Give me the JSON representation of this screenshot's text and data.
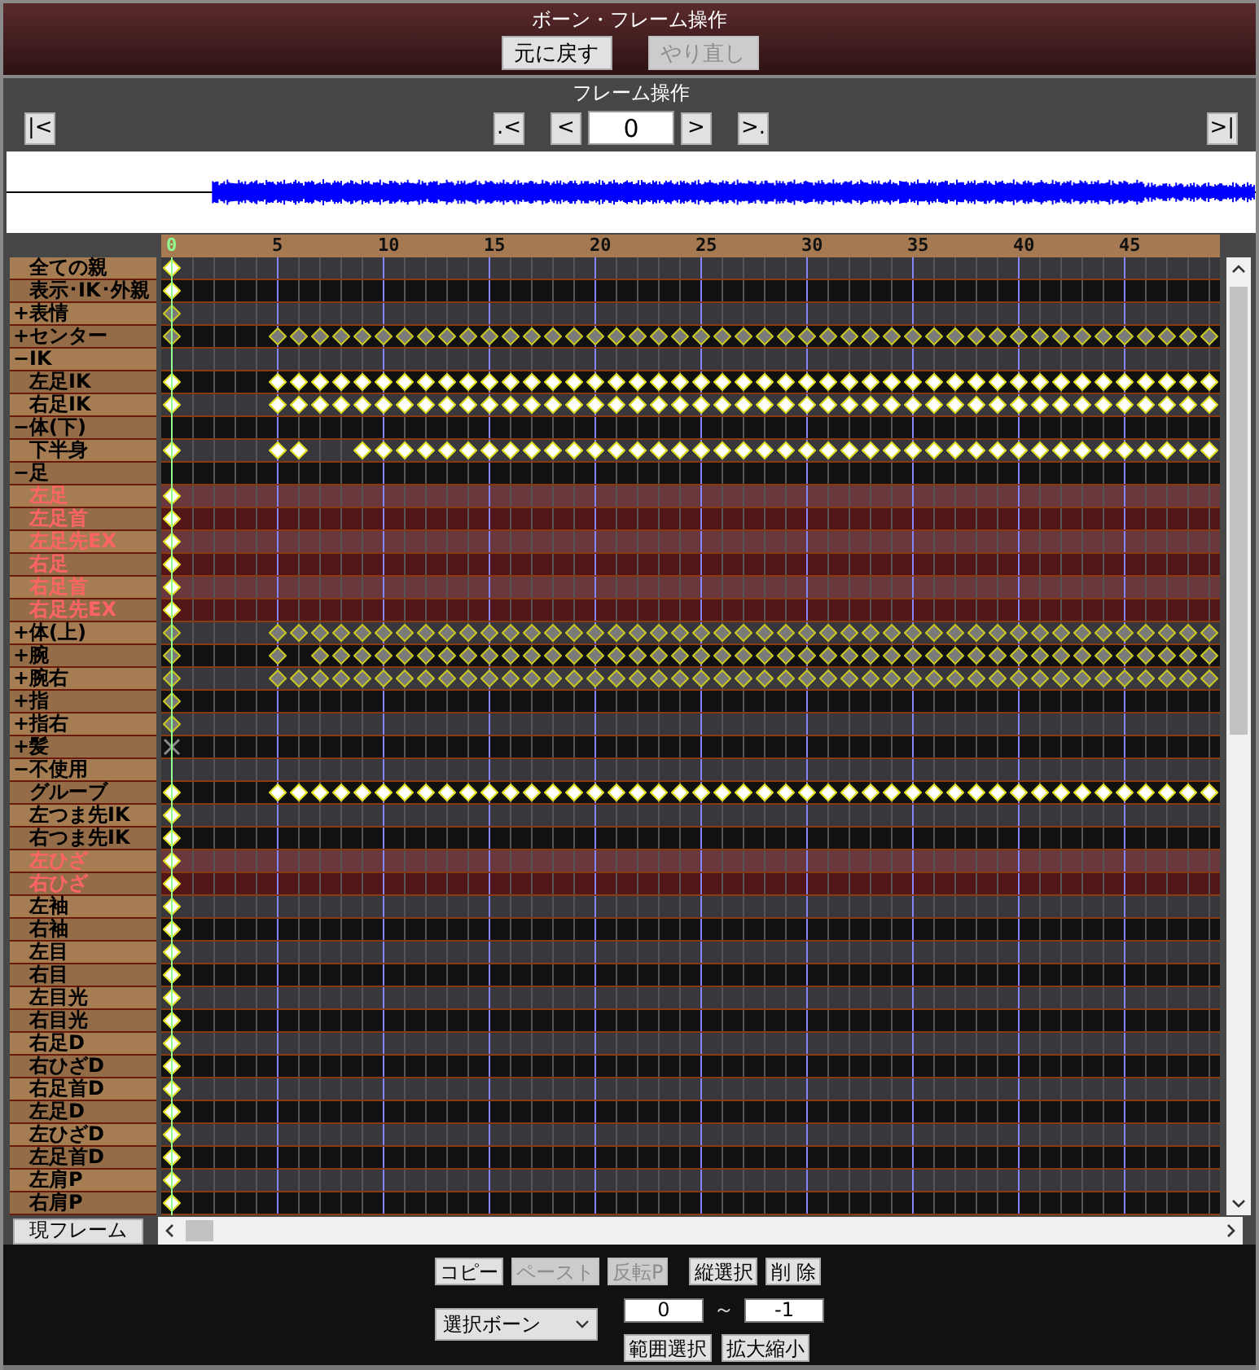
{
  "bone_panel": {
    "title": "ボーン・フレーム操作",
    "buttons": [
      {
        "label": "元に戻す",
        "disabled": false
      },
      {
        "label": "やり直し",
        "disabled": true
      }
    ]
  },
  "frame_panel": {
    "title": "フレーム操作",
    "first_button": "|<",
    "prev_key_button": ".<",
    "prev_button": "<",
    "frame_value": "0",
    "next_button": ">",
    "next_key_button": ">.",
    "last_button": ">|"
  },
  "timeline": {
    "ruler": [
      {
        "label": "0",
        "current": true
      },
      {
        "label": "5",
        "current": false
      },
      {
        "label": "10",
        "current": false
      },
      {
        "label": "15",
        "current": false
      },
      {
        "label": "20",
        "current": false
      },
      {
        "label": "25",
        "current": false
      },
      {
        "label": "30",
        "current": false
      },
      {
        "label": "35",
        "current": false
      },
      {
        "label": "40",
        "current": false
      },
      {
        "label": "45",
        "current": false
      }
    ],
    "rows": [
      {
        "label": "全ての親",
        "kind": "bone",
        "selected": false,
        "keyframes": [
          true,
          false,
          false,
          false,
          false,
          false,
          false,
          false,
          false,
          false,
          false,
          false,
          false,
          false,
          false,
          false,
          false,
          false,
          false,
          false,
          false,
          false,
          false,
          false,
          false,
          false,
          false,
          false,
          false,
          false,
          false,
          false,
          false,
          false,
          false,
          false,
          false,
          false,
          false,
          false,
          false,
          false,
          false,
          false,
          false,
          false,
          false,
          false,
          false,
          false
        ]
      },
      {
        "label": "表示･IK･外親",
        "kind": "bone",
        "selected": false,
        "keyframes": [
          true,
          false,
          false,
          false,
          false,
          false,
          false,
          false,
          false,
          false,
          false,
          false,
          false,
          false,
          false,
          false,
          false,
          false,
          false,
          false,
          false,
          false,
          false,
          false,
          false,
          false,
          false,
          false,
          false,
          false,
          false,
          false,
          false,
          false,
          false,
          false,
          false,
          false,
          false,
          false,
          false,
          false,
          false,
          false,
          false,
          false,
          false,
          false,
          false,
          false
        ]
      },
      {
        "label": "+表情",
        "kind": "group",
        "selected": false,
        "keyframes": [
          true,
          false,
          false,
          false,
          false,
          false,
          false,
          false,
          false,
          false,
          false,
          false,
          false,
          false,
          false,
          false,
          false,
          false,
          false,
          false,
          false,
          false,
          false,
          false,
          false,
          false,
          false,
          false,
          false,
          false,
          false,
          false,
          false,
          false,
          false,
          false,
          false,
          false,
          false,
          false,
          false,
          false,
          false,
          false,
          false,
          false,
          false,
          false,
          false,
          false
        ]
      },
      {
        "label": "+センター",
        "kind": "group",
        "selected": false,
        "keyframes": [
          true,
          false,
          false,
          false,
          false,
          true,
          true,
          true,
          true,
          true,
          true,
          true,
          true,
          true,
          true,
          true,
          true,
          true,
          true,
          true,
          true,
          true,
          true,
          true,
          true,
          true,
          true,
          true,
          true,
          true,
          true,
          true,
          true,
          true,
          true,
          true,
          true,
          true,
          true,
          true,
          true,
          true,
          true,
          true,
          true,
          true,
          true,
          true,
          true,
          true
        ]
      },
      {
        "label": "−IK",
        "kind": "open_group",
        "selected": false
      },
      {
        "label": "左足IK",
        "kind": "bone",
        "selected": false,
        "keyframes": [
          true,
          false,
          false,
          false,
          false,
          true,
          true,
          true,
          true,
          true,
          true,
          true,
          true,
          true,
          true,
          true,
          true,
          true,
          true,
          true,
          true,
          true,
          true,
          true,
          true,
          true,
          true,
          true,
          true,
          true,
          true,
          true,
          true,
          true,
          true,
          true,
          true,
          true,
          true,
          true,
          true,
          true,
          true,
          true,
          true,
          true,
          true,
          true,
          true,
          true
        ]
      },
      {
        "label": "右足IK",
        "kind": "bone",
        "selected": false,
        "keyframes": [
          true,
          false,
          false,
          false,
          false,
          true,
          true,
          true,
          true,
          true,
          true,
          true,
          true,
          true,
          true,
          true,
          true,
          true,
          true,
          true,
          true,
          true,
          true,
          true,
          true,
          true,
          true,
          true,
          true,
          true,
          true,
          true,
          true,
          true,
          true,
          true,
          true,
          true,
          true,
          true,
          true,
          true,
          true,
          true,
          true,
          true,
          true,
          true,
          true,
          true
        ]
      },
      {
        "label": "−体(下)",
        "kind": "open_group",
        "selected": false
      },
      {
        "label": "下半身",
        "kind": "bone",
        "selected": false,
        "keyframes": [
          true,
          false,
          false,
          false,
          false,
          true,
          true,
          false,
          false,
          true,
          true,
          true,
          true,
          true,
          true,
          true,
          true,
          true,
          true,
          true,
          true,
          true,
          true,
          true,
          true,
          true,
          true,
          true,
          true,
          true,
          true,
          true,
          true,
          true,
          true,
          true,
          true,
          true,
          true,
          true,
          true,
          true,
          true,
          true,
          true,
          true,
          true,
          true,
          true,
          true
        ]
      },
      {
        "label": "−足",
        "kind": "open_group",
        "selected": false
      },
      {
        "label": "左足",
        "kind": "bone",
        "selected": true,
        "keyframes": [
          true,
          false,
          false,
          false,
          false,
          false,
          false,
          false,
          false,
          false,
          false,
          false,
          false,
          false,
          false,
          false,
          false,
          false,
          false,
          false,
          false,
          false,
          false,
          false,
          false,
          false,
          false,
          false,
          false,
          false,
          false,
          false,
          false,
          false,
          false,
          false,
          false,
          false,
          false,
          false,
          false,
          false,
          false,
          false,
          false,
          false,
          false,
          false,
          false,
          false
        ]
      },
      {
        "label": "左足首",
        "kind": "bone",
        "selected": true,
        "keyframes": [
          true,
          false,
          false,
          false,
          false,
          false,
          false,
          false,
          false,
          false,
          false,
          false,
          false,
          false,
          false,
          false,
          false,
          false,
          false,
          false,
          false,
          false,
          false,
          false,
          false,
          false,
          false,
          false,
          false,
          false,
          false,
          false,
          false,
          false,
          false,
          false,
          false,
          false,
          false,
          false,
          false,
          false,
          false,
          false,
          false,
          false,
          false,
          false,
          false,
          false
        ]
      },
      {
        "label": "左足先EX",
        "kind": "bone",
        "selected": true,
        "keyframes": [
          true,
          false,
          false,
          false,
          false,
          false,
          false,
          false,
          false,
          false,
          false,
          false,
          false,
          false,
          false,
          false,
          false,
          false,
          false,
          false,
          false,
          false,
          false,
          false,
          false,
          false,
          false,
          false,
          false,
          false,
          false,
          false,
          false,
          false,
          false,
          false,
          false,
          false,
          false,
          false,
          false,
          false,
          false,
          false,
          false,
          false,
          false,
          false,
          false,
          false
        ]
      },
      {
        "label": "右足",
        "kind": "bone",
        "selected": true,
        "keyframes": [
          true,
          false,
          false,
          false,
          false,
          false,
          false,
          false,
          false,
          false,
          false,
          false,
          false,
          false,
          false,
          false,
          false,
          false,
          false,
          false,
          false,
          false,
          false,
          false,
          false,
          false,
          false,
          false,
          false,
          false,
          false,
          false,
          false,
          false,
          false,
          false,
          false,
          false,
          false,
          false,
          false,
          false,
          false,
          false,
          false,
          false,
          false,
          false,
          false,
          false
        ]
      },
      {
        "label": "右足首",
        "kind": "bone",
        "selected": true,
        "keyframes": [
          true,
          false,
          false,
          false,
          false,
          false,
          false,
          false,
          false,
          false,
          false,
          false,
          false,
          false,
          false,
          false,
          false,
          false,
          false,
          false,
          false,
          false,
          false,
          false,
          false,
          false,
          false,
          false,
          false,
          false,
          false,
          false,
          false,
          false,
          false,
          false,
          false,
          false,
          false,
          false,
          false,
          false,
          false,
          false,
          false,
          false,
          false,
          false,
          false,
          false
        ]
      },
      {
        "label": "右足先EX",
        "kind": "bone",
        "selected": true,
        "keyframes": [
          true,
          false,
          false,
          false,
          false,
          false,
          false,
          false,
          false,
          false,
          false,
          false,
          false,
          false,
          false,
          false,
          false,
          false,
          false,
          false,
          false,
          false,
          false,
          false,
          false,
          false,
          false,
          false,
          false,
          false,
          false,
          false,
          false,
          false,
          false,
          false,
          false,
          false,
          false,
          false,
          false,
          false,
          false,
          false,
          false,
          false,
          false,
          false,
          false,
          false
        ]
      },
      {
        "label": "+体(上)",
        "kind": "group",
        "selected": false,
        "keyframes": [
          true,
          false,
          false,
          false,
          false,
          true,
          true,
          true,
          true,
          true,
          true,
          true,
          true,
          true,
          true,
          true,
          true,
          true,
          true,
          true,
          true,
          true,
          true,
          true,
          true,
          true,
          true,
          true,
          true,
          true,
          true,
          true,
          true,
          true,
          true,
          true,
          true,
          true,
          true,
          true,
          true,
          true,
          true,
          true,
          true,
          true,
          true,
          true,
          true,
          true
        ]
      },
      {
        "label": "+腕",
        "kind": "group",
        "selected": false,
        "keyframes": [
          true,
          false,
          false,
          false,
          false,
          true,
          false,
          true,
          true,
          true,
          true,
          true,
          true,
          true,
          true,
          true,
          true,
          true,
          true,
          true,
          true,
          true,
          true,
          true,
          true,
          true,
          true,
          true,
          true,
          true,
          true,
          true,
          true,
          true,
          true,
          true,
          true,
          true,
          true,
          true,
          true,
          true,
          true,
          true,
          true,
          true,
          true,
          true,
          true,
          true
        ]
      },
      {
        "label": "+腕右",
        "kind": "group",
        "selected": false,
        "keyframes": [
          true,
          false,
          false,
          false,
          false,
          true,
          true,
          true,
          true,
          true,
          true,
          true,
          true,
          true,
          true,
          true,
          true,
          true,
          true,
          true,
          true,
          true,
          true,
          true,
          true,
          true,
          true,
          true,
          true,
          true,
          true,
          true,
          true,
          true,
          true,
          true,
          true,
          true,
          true,
          true,
          true,
          true,
          true,
          true,
          true,
          true,
          true,
          true,
          true,
          true
        ]
      },
      {
        "label": "+指",
        "kind": "group",
        "selected": false,
        "keyframes": [
          true,
          false,
          false,
          false,
          false,
          false,
          false,
          false,
          false,
          false,
          false,
          false,
          false,
          false,
          false,
          false,
          false,
          false,
          false,
          false,
          false,
          false,
          false,
          false,
          false,
          false,
          false,
          false,
          false,
          false,
          false,
          false,
          false,
          false,
          false,
          false,
          false,
          false,
          false,
          false,
          false,
          false,
          false,
          false,
          false,
          false,
          false,
          false,
          false,
          false
        ]
      },
      {
        "label": "+指右",
        "kind": "group",
        "selected": false,
        "keyframes": [
          true,
          false,
          false,
          false,
          false,
          false,
          false,
          false,
          false,
          false,
          false,
          false,
          false,
          false,
          false,
          false,
          false,
          false,
          false,
          false,
          false,
          false,
          false,
          false,
          false,
          false,
          false,
          false,
          false,
          false,
          false,
          false,
          false,
          false,
          false,
          false,
          false,
          false,
          false,
          false,
          false,
          false,
          false,
          false,
          false,
          false,
          false,
          false,
          false,
          false
        ]
      },
      {
        "label": "+髪",
        "kind": "empty_group",
        "selected": false,
        "keyframes": [
          true,
          false,
          false,
          false,
          false,
          false,
          false,
          false,
          false,
          false,
          false,
          false,
          false,
          false,
          false,
          false,
          false,
          false,
          false,
          false,
          false,
          false,
          false,
          false,
          false,
          false,
          false,
          false,
          false,
          false,
          false,
          false,
          false,
          false,
          false,
          false,
          false,
          false,
          false,
          false,
          false,
          false,
          false,
          false,
          false,
          false,
          false,
          false,
          false,
          false
        ]
      },
      {
        "label": "−不使用",
        "kind": "open_group",
        "selected": false
      },
      {
        "label": "グルーブ",
        "kind": "bone",
        "selected": false,
        "keyframes": [
          true,
          false,
          false,
          false,
          false,
          true,
          true,
          true,
          true,
          true,
          true,
          true,
          true,
          true,
          true,
          true,
          true,
          true,
          true,
          true,
          true,
          true,
          true,
          true,
          true,
          true,
          true,
          true,
          true,
          true,
          true,
          true,
          true,
          true,
          true,
          true,
          true,
          true,
          true,
          true,
          true,
          true,
          true,
          true,
          true,
          true,
          true,
          true,
          true,
          true
        ]
      },
      {
        "label": "左つま先IK",
        "kind": "bone",
        "selected": false,
        "keyframes": [
          true,
          false,
          false,
          false,
          false,
          false,
          false,
          false,
          false,
          false,
          false,
          false,
          false,
          false,
          false,
          false,
          false,
          false,
          false,
          false,
          false,
          false,
          false,
          false,
          false,
          false,
          false,
          false,
          false,
          false,
          false,
          false,
          false,
          false,
          false,
          false,
          false,
          false,
          false,
          false,
          false,
          false,
          false,
          false,
          false,
          false,
          false,
          false,
          false,
          false
        ]
      },
      {
        "label": "右つま先IK",
        "kind": "bone",
        "selected": false,
        "keyframes": [
          true,
          false,
          false,
          false,
          false,
          false,
          false,
          false,
          false,
          false,
          false,
          false,
          false,
          false,
          false,
          false,
          false,
          false,
          false,
          false,
          false,
          false,
          false,
          false,
          false,
          false,
          false,
          false,
          false,
          false,
          false,
          false,
          false,
          false,
          false,
          false,
          false,
          false,
          false,
          false,
          false,
          false,
          false,
          false,
          false,
          false,
          false,
          false,
          false,
          false
        ]
      },
      {
        "label": "左ひざ",
        "kind": "bone",
        "selected": true,
        "keyframes": [
          true,
          false,
          false,
          false,
          false,
          false,
          false,
          false,
          false,
          false,
          false,
          false,
          false,
          false,
          false,
          false,
          false,
          false,
          false,
          false,
          false,
          false,
          false,
          false,
          false,
          false,
          false,
          false,
          false,
          false,
          false,
          false,
          false,
          false,
          false,
          false,
          false,
          false,
          false,
          false,
          false,
          false,
          false,
          false,
          false,
          false,
          false,
          false,
          false,
          false
        ]
      },
      {
        "label": "右ひざ",
        "kind": "bone",
        "selected": true,
        "keyframes": [
          true,
          false,
          false,
          false,
          false,
          false,
          false,
          false,
          false,
          false,
          false,
          false,
          false,
          false,
          false,
          false,
          false,
          false,
          false,
          false,
          false,
          false,
          false,
          false,
          false,
          false,
          false,
          false,
          false,
          false,
          false,
          false,
          false,
          false,
          false,
          false,
          false,
          false,
          false,
          false,
          false,
          false,
          false,
          false,
          false,
          false,
          false,
          false,
          false,
          false
        ]
      },
      {
        "label": "左袖",
        "kind": "bone",
        "selected": false,
        "keyframes": [
          true,
          false,
          false,
          false,
          false,
          false,
          false,
          false,
          false,
          false,
          false,
          false,
          false,
          false,
          false,
          false,
          false,
          false,
          false,
          false,
          false,
          false,
          false,
          false,
          false,
          false,
          false,
          false,
          false,
          false,
          false,
          false,
          false,
          false,
          false,
          false,
          false,
          false,
          false,
          false,
          false,
          false,
          false,
          false,
          false,
          false,
          false,
          false,
          false,
          false
        ]
      },
      {
        "label": "右袖",
        "kind": "bone",
        "selected": false,
        "keyframes": [
          true,
          false,
          false,
          false,
          false,
          false,
          false,
          false,
          false,
          false,
          false,
          false,
          false,
          false,
          false,
          false,
          false,
          false,
          false,
          false,
          false,
          false,
          false,
          false,
          false,
          false,
          false,
          false,
          false,
          false,
          false,
          false,
          false,
          false,
          false,
          false,
          false,
          false,
          false,
          false,
          false,
          false,
          false,
          false,
          false,
          false,
          false,
          false,
          false,
          false
        ]
      },
      {
        "label": "左目",
        "kind": "bone",
        "selected": false,
        "keyframes": [
          true,
          false,
          false,
          false,
          false,
          false,
          false,
          false,
          false,
          false,
          false,
          false,
          false,
          false,
          false,
          false,
          false,
          false,
          false,
          false,
          false,
          false,
          false,
          false,
          false,
          false,
          false,
          false,
          false,
          false,
          false,
          false,
          false,
          false,
          false,
          false,
          false,
          false,
          false,
          false,
          false,
          false,
          false,
          false,
          false,
          false,
          false,
          false,
          false,
          false
        ]
      },
      {
        "label": "右目",
        "kind": "bone",
        "selected": false,
        "keyframes": [
          true,
          false,
          false,
          false,
          false,
          false,
          false,
          false,
          false,
          false,
          false,
          false,
          false,
          false,
          false,
          false,
          false,
          false,
          false,
          false,
          false,
          false,
          false,
          false,
          false,
          false,
          false,
          false,
          false,
          false,
          false,
          false,
          false,
          false,
          false,
          false,
          false,
          false,
          false,
          false,
          false,
          false,
          false,
          false,
          false,
          false,
          false,
          false,
          false,
          false
        ]
      },
      {
        "label": "左目光",
        "kind": "bone",
        "selected": false,
        "keyframes": [
          true,
          false,
          false,
          false,
          false,
          false,
          false,
          false,
          false,
          false,
          false,
          false,
          false,
          false,
          false,
          false,
          false,
          false,
          false,
          false,
          false,
          false,
          false,
          false,
          false,
          false,
          false,
          false,
          false,
          false,
          false,
          false,
          false,
          false,
          false,
          false,
          false,
          false,
          false,
          false,
          false,
          false,
          false,
          false,
          false,
          false,
          false,
          false,
          false,
          false
        ]
      },
      {
        "label": "右目光",
        "kind": "bone",
        "selected": false,
        "keyframes": [
          true,
          false,
          false,
          false,
          false,
          false,
          false,
          false,
          false,
          false,
          false,
          false,
          false,
          false,
          false,
          false,
          false,
          false,
          false,
          false,
          false,
          false,
          false,
          false,
          false,
          false,
          false,
          false,
          false,
          false,
          false,
          false,
          false,
          false,
          false,
          false,
          false,
          false,
          false,
          false,
          false,
          false,
          false,
          false,
          false,
          false,
          false,
          false,
          false,
          false
        ]
      },
      {
        "label": "右足D",
        "kind": "bone",
        "selected": false,
        "keyframes": [
          true,
          false,
          false,
          false,
          false,
          false,
          false,
          false,
          false,
          false,
          false,
          false,
          false,
          false,
          false,
          false,
          false,
          false,
          false,
          false,
          false,
          false,
          false,
          false,
          false,
          false,
          false,
          false,
          false,
          false,
          false,
          false,
          false,
          false,
          false,
          false,
          false,
          false,
          false,
          false,
          false,
          false,
          false,
          false,
          false,
          false,
          false,
          false,
          false,
          false
        ]
      },
      {
        "label": "右ひざD",
        "kind": "bone",
        "selected": false,
        "keyframes": [
          true,
          false,
          false,
          false,
          false,
          false,
          false,
          false,
          false,
          false,
          false,
          false,
          false,
          false,
          false,
          false,
          false,
          false,
          false,
          false,
          false,
          false,
          false,
          false,
          false,
          false,
          false,
          false,
          false,
          false,
          false,
          false,
          false,
          false,
          false,
          false,
          false,
          false,
          false,
          false,
          false,
          false,
          false,
          false,
          false,
          false,
          false,
          false,
          false,
          false
        ]
      },
      {
        "label": "右足首D",
        "kind": "bone",
        "selected": false,
        "keyframes": [
          true,
          false,
          false,
          false,
          false,
          false,
          false,
          false,
          false,
          false,
          false,
          false,
          false,
          false,
          false,
          false,
          false,
          false,
          false,
          false,
          false,
          false,
          false,
          false,
          false,
          false,
          false,
          false,
          false,
          false,
          false,
          false,
          false,
          false,
          false,
          false,
          false,
          false,
          false,
          false,
          false,
          false,
          false,
          false,
          false,
          false,
          false,
          false,
          false,
          false
        ]
      },
      {
        "label": "左足D",
        "kind": "bone",
        "selected": false,
        "keyframes": [
          true,
          false,
          false,
          false,
          false,
          false,
          false,
          false,
          false,
          false,
          false,
          false,
          false,
          false,
          false,
          false,
          false,
          false,
          false,
          false,
          false,
          false,
          false,
          false,
          false,
          false,
          false,
          false,
          false,
          false,
          false,
          false,
          false,
          false,
          false,
          false,
          false,
          false,
          false,
          false,
          false,
          false,
          false,
          false,
          false,
          false,
          false,
          false,
          false,
          false
        ]
      },
      {
        "label": "左ひざD",
        "kind": "bone",
        "selected": false,
        "keyframes": [
          true,
          false,
          false,
          false,
          false,
          false,
          false,
          false,
          false,
          false,
          false,
          false,
          false,
          false,
          false,
          false,
          false,
          false,
          false,
          false,
          false,
          false,
          false,
          false,
          false,
          false,
          false,
          false,
          false,
          false,
          false,
          false,
          false,
          false,
          false,
          false,
          false,
          false,
          false,
          false,
          false,
          false,
          false,
          false,
          false,
          false,
          false,
          false,
          false,
          false
        ]
      },
      {
        "label": "左足首D",
        "kind": "bone",
        "selected": false,
        "keyframes": [
          true,
          false,
          false,
          false,
          false,
          false,
          false,
          false,
          false,
          false,
          false,
          false,
          false,
          false,
          false,
          false,
          false,
          false,
          false,
          false,
          false,
          false,
          false,
          false,
          false,
          false,
          false,
          false,
          false,
          false,
          false,
          false,
          false,
          false,
          false,
          false,
          false,
          false,
          false,
          false,
          false,
          false,
          false,
          false,
          false,
          false,
          false,
          false,
          false,
          false
        ]
      },
      {
        "label": "左肩P",
        "kind": "bone",
        "selected": false,
        "keyframes": [
          true,
          false,
          false,
          false,
          false,
          false,
          false,
          false,
          false,
          false,
          false,
          false,
          false,
          false,
          false,
          false,
          false,
          false,
          false,
          false,
          false,
          false,
          false,
          false,
          false,
          false,
          false,
          false,
          false,
          false,
          false,
          false,
          false,
          false,
          false,
          false,
          false,
          false,
          false,
          false,
          false,
          false,
          false,
          false,
          false,
          false,
          false,
          false,
          false,
          false
        ]
      },
      {
        "label": "右肩P",
        "kind": "bone",
        "selected": false,
        "keyframes": [
          true,
          false,
          false,
          false,
          false,
          false,
          false,
          false,
          false,
          false,
          false,
          false,
          false,
          false,
          false,
          false,
          false,
          false,
          false,
          false,
          false,
          false,
          false,
          false,
          false,
          false,
          false,
          false,
          false,
          false,
          false,
          false,
          false,
          false,
          false,
          false,
          false,
          false,
          false,
          false,
          false,
          false,
          false,
          false,
          false,
          false,
          false,
          false,
          false,
          false
        ]
      }
    ],
    "current_frame_button": "現フレーム"
  },
  "edit_controls": {
    "buttons": [
      {
        "label": "コピー",
        "disabled": false
      },
      {
        "label": "ペースト",
        "disabled": true
      },
      {
        "label": "反転P",
        "disabled": true
      },
      {
        "label": "縦選択",
        "disabled": false
      },
      {
        "label": "削 除",
        "disabled": false
      }
    ],
    "bone_select": "選択ボーン",
    "range_start": "0",
    "range_separator": "～",
    "range_end": "-1",
    "range_buttons": [
      "範囲選択",
      "拡大縮小"
    ]
  }
}
